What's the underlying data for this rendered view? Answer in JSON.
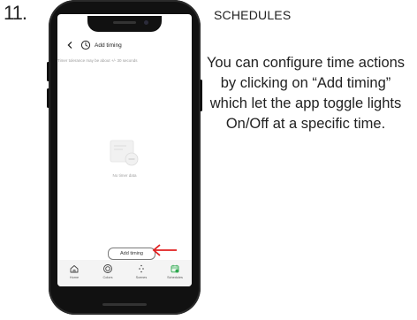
{
  "step": {
    "number": "11."
  },
  "section": {
    "heading": "SCHEDULES"
  },
  "description": {
    "text": "You can configure time actions by clicking on “Add timing” which let the app toggle lights On/Off at a specific time."
  },
  "app": {
    "header": {
      "title": "Add timing",
      "back_icon": "chevron-left-icon",
      "title_icon": "timer-icon"
    },
    "tolerance_note": "Timer tolerance may be about +/- 30 seconds",
    "empty_state": {
      "text": "No timer data",
      "icon": "empty-document-icon"
    },
    "add_button": {
      "label": "Add timing"
    },
    "tabs": [
      {
        "label": "Home",
        "icon": "house-icon"
      },
      {
        "label": "Colors",
        "icon": "color-ring-icon"
      },
      {
        "label": "Scenes",
        "icon": "sparkle-icon"
      },
      {
        "label": "Schedules",
        "icon": "calendar-icon",
        "active": true
      }
    ]
  },
  "colors": {
    "annotation_arrow": "#e02020",
    "active_tab_accent": "#2fa84f"
  }
}
